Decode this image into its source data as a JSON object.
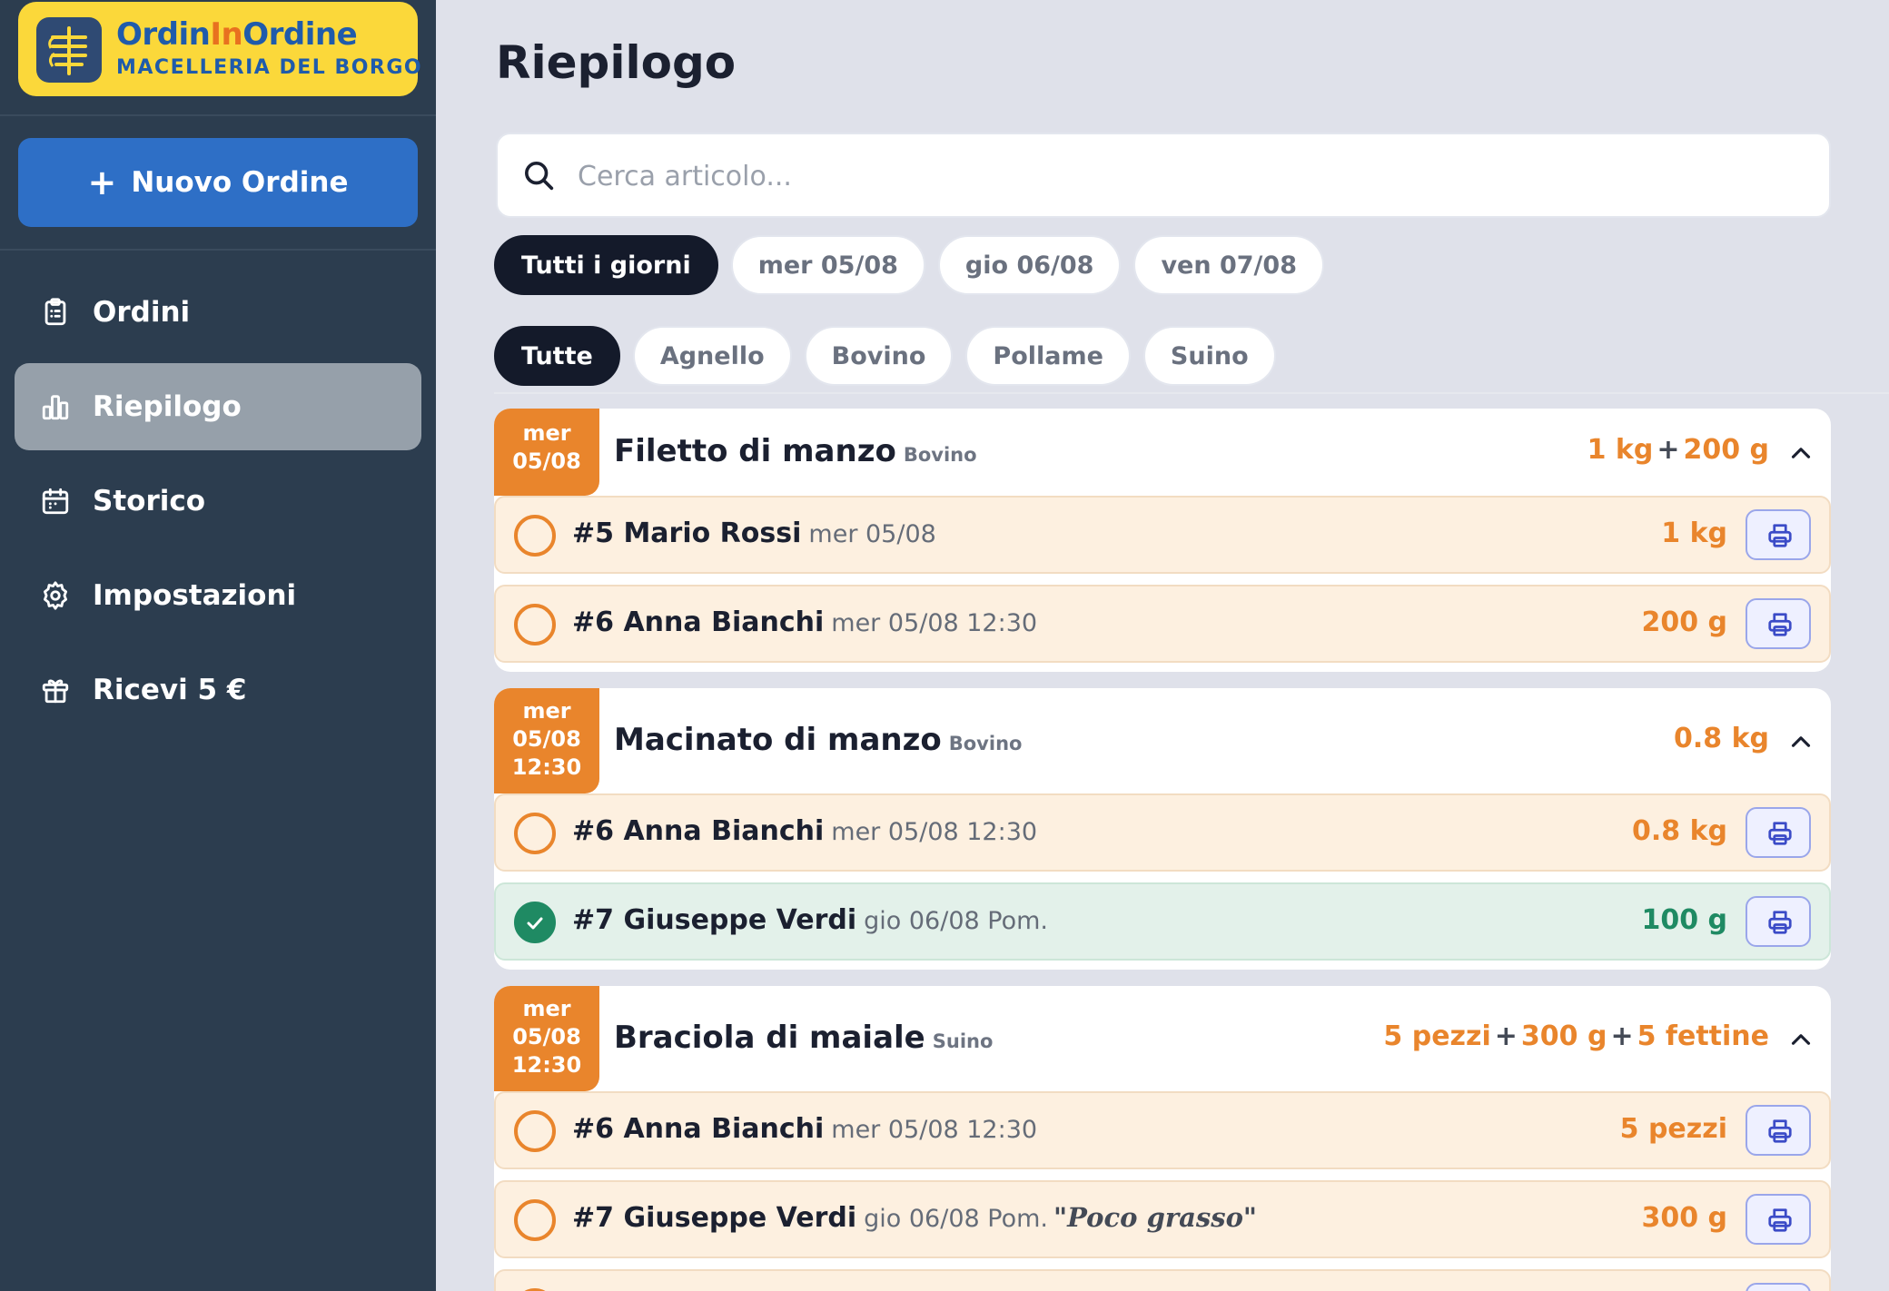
{
  "brand": {
    "name_part1": "Ordin",
    "name_accent": "In",
    "name_part2": "Ordine",
    "subtitle": "MACELLERIA DEL BORGO"
  },
  "sidebar": {
    "new_order_label": "Nuovo Ordine",
    "items": [
      {
        "label": "Ordini",
        "icon": "clipboard-icon"
      },
      {
        "label": "Riepilogo",
        "icon": "bar-chart-icon",
        "active": true
      },
      {
        "label": "Storico",
        "icon": "calendar-icon"
      },
      {
        "label": "Impostazioni",
        "icon": "gear-icon"
      },
      {
        "label": "Ricevi 5 €",
        "icon": "gift-icon"
      }
    ]
  },
  "main": {
    "title": "Riepilogo",
    "search_placeholder": "Cerca articolo...",
    "day_filters": [
      "Tutti i giorni",
      "mer 05/08",
      "gio 06/08",
      "ven 07/08"
    ],
    "category_filters": [
      "Tutte",
      "Agnello",
      "Bovino",
      "Pollame",
      "Suino"
    ],
    "groups": [
      {
        "date_line1": "mer",
        "date_line2": "05/08",
        "product": "Filetto di manzo",
        "category": "Bovino",
        "qty_parts": [
          "1 kg",
          "200 g"
        ],
        "rows": [
          {
            "order": "#5 Mario Rossi",
            "when": "mer 05/08",
            "amount": "1 kg",
            "done": false
          },
          {
            "order": "#6 Anna Bianchi",
            "when": "mer 05/08 12:30",
            "amount": "200 g",
            "done": false
          }
        ]
      },
      {
        "date_line1": "mer",
        "date_line2": "05/08",
        "date_line3": "12:30",
        "product": "Macinato di manzo",
        "category": "Bovino",
        "qty_parts": [
          "0.8 kg"
        ],
        "rows": [
          {
            "order": "#6 Anna Bianchi",
            "when": "mer 05/08 12:30",
            "amount": "0.8 kg",
            "done": false
          },
          {
            "order": "#7 Giuseppe Verdi",
            "when": "gio 06/08 Pom.",
            "amount": "100 g",
            "done": true
          }
        ]
      },
      {
        "date_line1": "mer",
        "date_line2": "05/08",
        "date_line3": "12:30",
        "product": "Braciola di maiale",
        "category": "Suino",
        "qty_parts": [
          "5 pezzi",
          "300 g",
          "5 fettine"
        ],
        "rows": [
          {
            "order": "#6 Anna Bianchi",
            "when": "mer 05/08 12:30",
            "amount": "5 pezzi",
            "done": false
          },
          {
            "order": "#7 Giuseppe Verdi",
            "when": "gio 06/08 Pom.",
            "note": "\"Poco grasso\"",
            "amount": "300 g",
            "done": false
          }
        ]
      }
    ],
    "plus_sign": "+"
  },
  "colors": {
    "sidebar_bg": "#2c3d4f",
    "brand_yellow": "#fbd83a",
    "brand_blue": "#1f5bab",
    "primary_button": "#2e6fc6",
    "accent_orange": "#e9852c",
    "done_green": "#1f8a63"
  }
}
